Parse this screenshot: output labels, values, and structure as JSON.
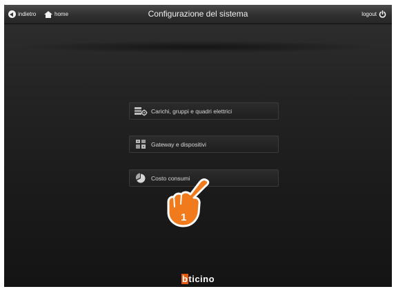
{
  "header": {
    "back_label": "indietro",
    "home_label": "home",
    "title": "Configurazione del sistema",
    "logout_label": "logout"
  },
  "menu": [
    {
      "label": "Carichi, gruppi e quadri elettrici",
      "icon": "electrical-panel-icon"
    },
    {
      "label": "Gateway e dispositivi",
      "icon": "gateway-icon"
    },
    {
      "label": "Costo consumi",
      "icon": "cost-pie-icon"
    }
  ],
  "annotation": {
    "step_number": "1",
    "icon": "pointing-hand-icon",
    "color": "#f07a1c"
  },
  "brand": {
    "logo_prefix": "b",
    "logo_rest": "ticino",
    "accent": "#e8590c"
  }
}
